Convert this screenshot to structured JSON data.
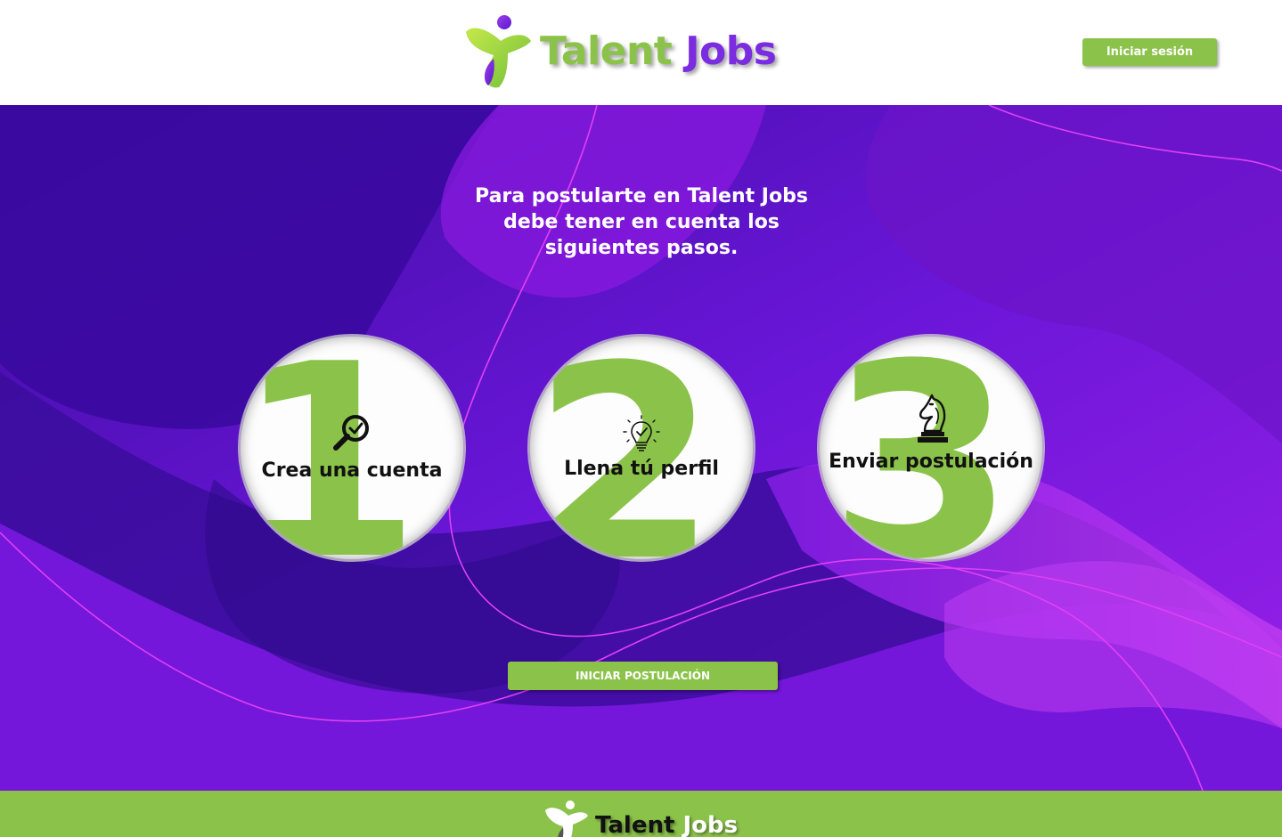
{
  "header": {
    "logo": {
      "word1": "Talent",
      "word2": "Jobs"
    },
    "login_label": "Iniciar sesión"
  },
  "hero": {
    "title": "Para postularte en Talent Jobs debe tener en cuenta los siguientes pasos.",
    "steps": [
      {
        "number": "1",
        "label": "Crea una cuenta",
        "icon": "magnifier-check-icon"
      },
      {
        "number": "2",
        "label": "Llena tú perfil",
        "icon": "lightbulb-check-icon"
      },
      {
        "number": "3",
        "label": "Enviar postulación",
        "icon": "chess-knight-icon"
      }
    ],
    "apply_label": "INICIAR POSTULACIÓN"
  },
  "footer": {
    "logo": {
      "word1": "Talent",
      "word2": "Jobs"
    }
  },
  "colors": {
    "brand_green": "#8bc34a",
    "brand_purple": "#7b2be0",
    "hero_dark": "#3a0a9a",
    "hero_light": "#a020f0"
  }
}
